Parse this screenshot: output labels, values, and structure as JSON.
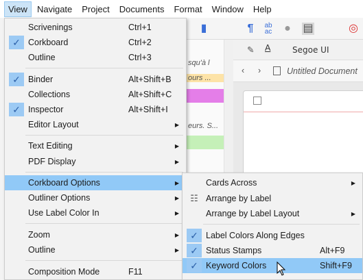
{
  "menubar": {
    "items": [
      "View",
      "Navigate",
      "Project",
      "Documents",
      "Format",
      "Window",
      "Help"
    ]
  },
  "format_bar": {
    "font": "Segoe UI"
  },
  "nav_bar": {
    "doc_title": "Untitled Document"
  },
  "binder_strip": [
    "squ'à l",
    "ours ...",
    "",
    "eurs. S...",
    ""
  ],
  "view_menu": {
    "items": [
      {
        "label": "Scrivenings",
        "shortcut": "Ctrl+1",
        "checked": false
      },
      {
        "label": "Corkboard",
        "shortcut": "Ctrl+2",
        "checked": true
      },
      {
        "label": "Outline",
        "shortcut": "Ctrl+3",
        "checked": false
      },
      {
        "label": "Binder",
        "shortcut": "Alt+Shift+B",
        "checked": true
      },
      {
        "label": "Collections",
        "shortcut": "Alt+Shift+C",
        "checked": false
      },
      {
        "label": "Inspector",
        "shortcut": "Alt+Shift+I",
        "checked": true
      },
      {
        "label": "Editor Layout",
        "submenu": true
      },
      {
        "label": "Text Editing",
        "submenu": true
      },
      {
        "label": "PDF Display",
        "submenu": true
      },
      {
        "label": "Corkboard Options",
        "submenu": true,
        "highlighted": true
      },
      {
        "label": "Outliner Options",
        "submenu": true
      },
      {
        "label": "Use Label Color In",
        "submenu": true
      },
      {
        "label": "Zoom",
        "submenu": true
      },
      {
        "label": "Outline",
        "submenu": true
      },
      {
        "label": "Composition Mode",
        "shortcut": "F11"
      }
    ]
  },
  "corkboard_submenu": {
    "items": [
      {
        "label": "Cards Across",
        "submenu": true
      },
      {
        "label": "Arrange by Label",
        "icon": "arrange-icon"
      },
      {
        "label": "Arrange by Label Layout",
        "submenu": true
      },
      {
        "label": "Label Colors Along Edges",
        "checked": true
      },
      {
        "label": "Status Stamps",
        "shortcut": "Alt+F9",
        "checked": true
      },
      {
        "label": "Keyword Colors",
        "shortcut": "Shift+F9",
        "checked": true,
        "highlighted": true
      }
    ]
  }
}
